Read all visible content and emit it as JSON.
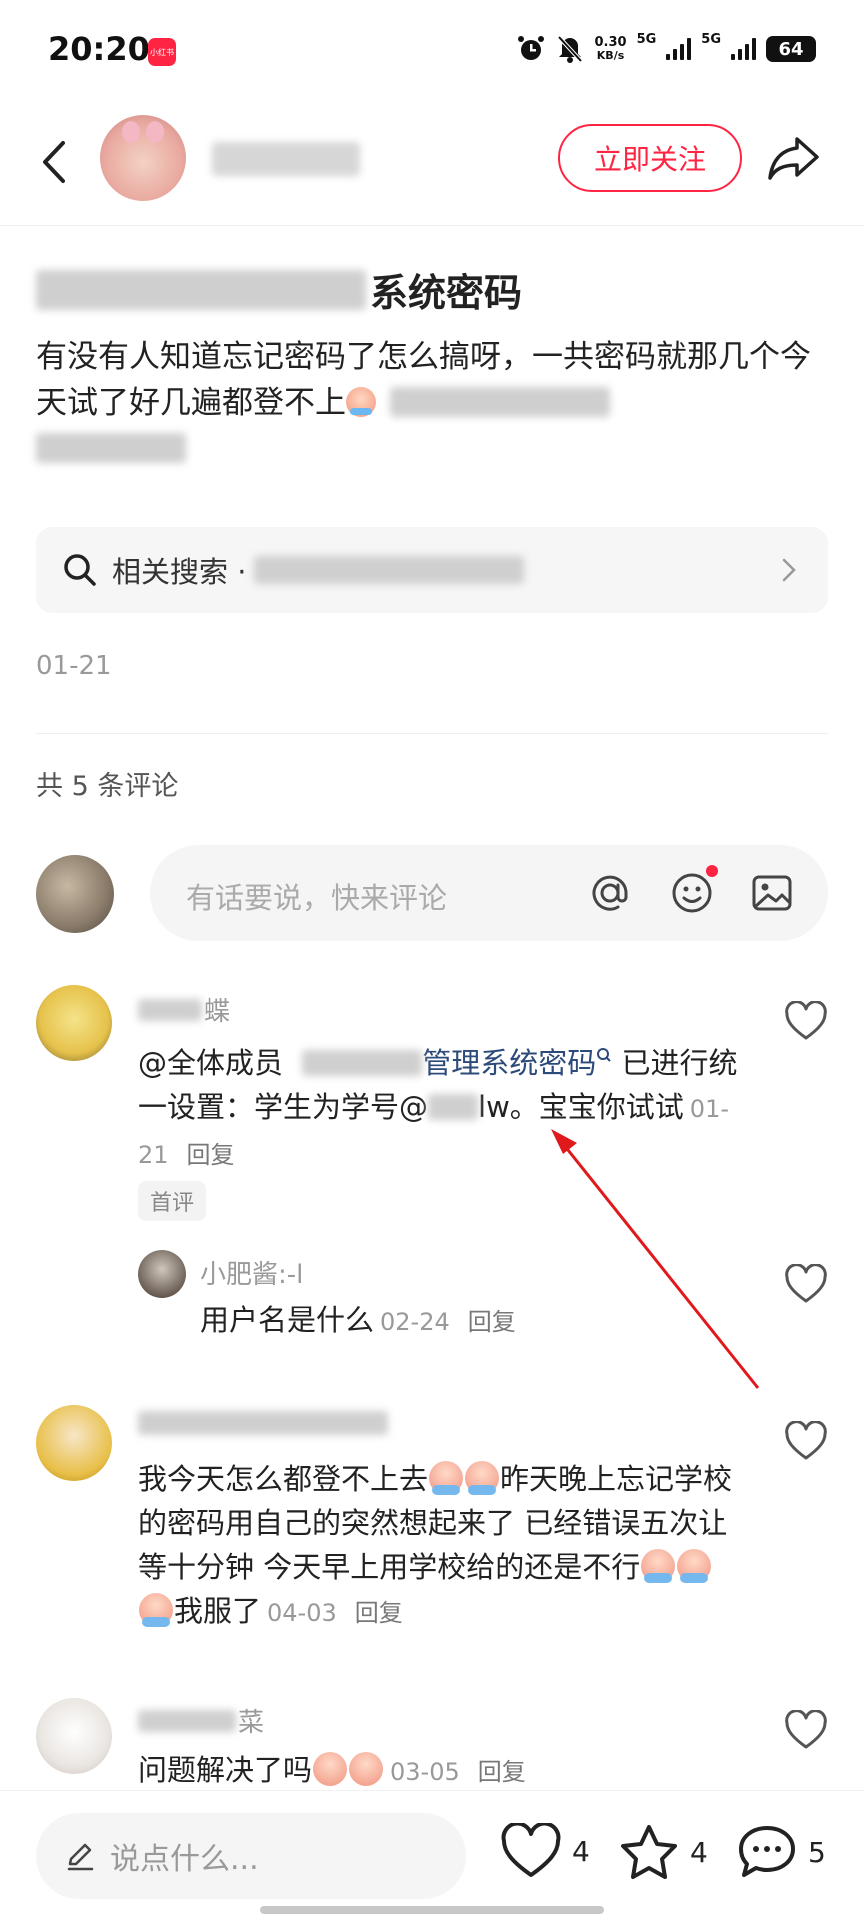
{
  "status_bar": {
    "time": "20:20",
    "app_badge": "小红书",
    "net_speed_value": "0.30",
    "net_speed_unit": "KB/s",
    "sim1": "5G",
    "sim2": "5G",
    "battery": "64"
  },
  "header": {
    "follow_label": "立即关注"
  },
  "post": {
    "title_visible": "系统密码",
    "body": "有没有人知道忘记密码了怎么搞呀，一共密码就那几个今天试了好几遍都登不上",
    "related_search_label": "相关搜索 ·",
    "date": "01-21"
  },
  "comments_section": {
    "count_label": "共 5 条评论",
    "input_placeholder": "有话要说，快来评论"
  },
  "comments": [
    {
      "name_visible": "蝶",
      "text_prefix": "@全体成员",
      "link_text": "管理系统密码",
      "text_after_link": "已进行统一设置：学生为学号@",
      "text_tail": "lw。宝宝你试试",
      "date": "01-21",
      "reply": "回复",
      "tag": "首评"
    },
    {
      "name": "小肥酱:-l",
      "text": "用户名是什么",
      "date": "02-24",
      "reply": "回复"
    },
    {
      "text_part1": "我今天怎么都登不上去",
      "text_part2": "昨天晚上忘记学校的密码用自己的突然想起来了 已经错误五次让等十分钟 今天早上用学校给的还是不行",
      "text_part3": "我服了",
      "date": "04-03",
      "reply": "回复"
    },
    {
      "name_visible": "菜",
      "text": "问题解决了吗",
      "date": "03-05",
      "reply": "回复"
    }
  ],
  "bottom_bar": {
    "say_placeholder": "说点什么...",
    "likes": "4",
    "collects": "4",
    "comments": "5"
  },
  "colors": {
    "accent": "#ff2442",
    "link": "#2c4a7a",
    "annotation_arrow": "#e0191c"
  },
  "icons": [
    "back-icon",
    "share-icon",
    "search-icon",
    "chevron-right-icon",
    "at-icon",
    "emoji-icon",
    "image-icon",
    "heart-icon",
    "star-icon",
    "comment-icon",
    "pen-icon"
  ]
}
